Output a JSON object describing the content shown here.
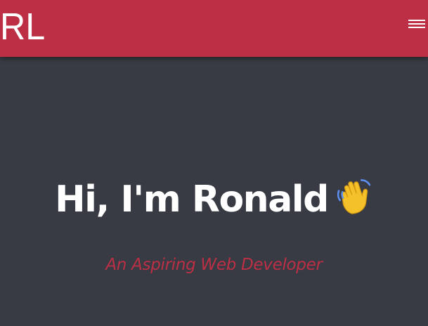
{
  "navbar": {
    "logo_text": "RL",
    "menu_icon": "hamburger-menu-icon",
    "accent_color": "#bd2f45"
  },
  "hero": {
    "greeting": "Hi, I'm Ronald",
    "wave_icon": "waving-hand-icon",
    "subtitle": "An Aspiring Web Developer",
    "background_color": "#383b43",
    "subtitle_color": "#bd2f45"
  }
}
